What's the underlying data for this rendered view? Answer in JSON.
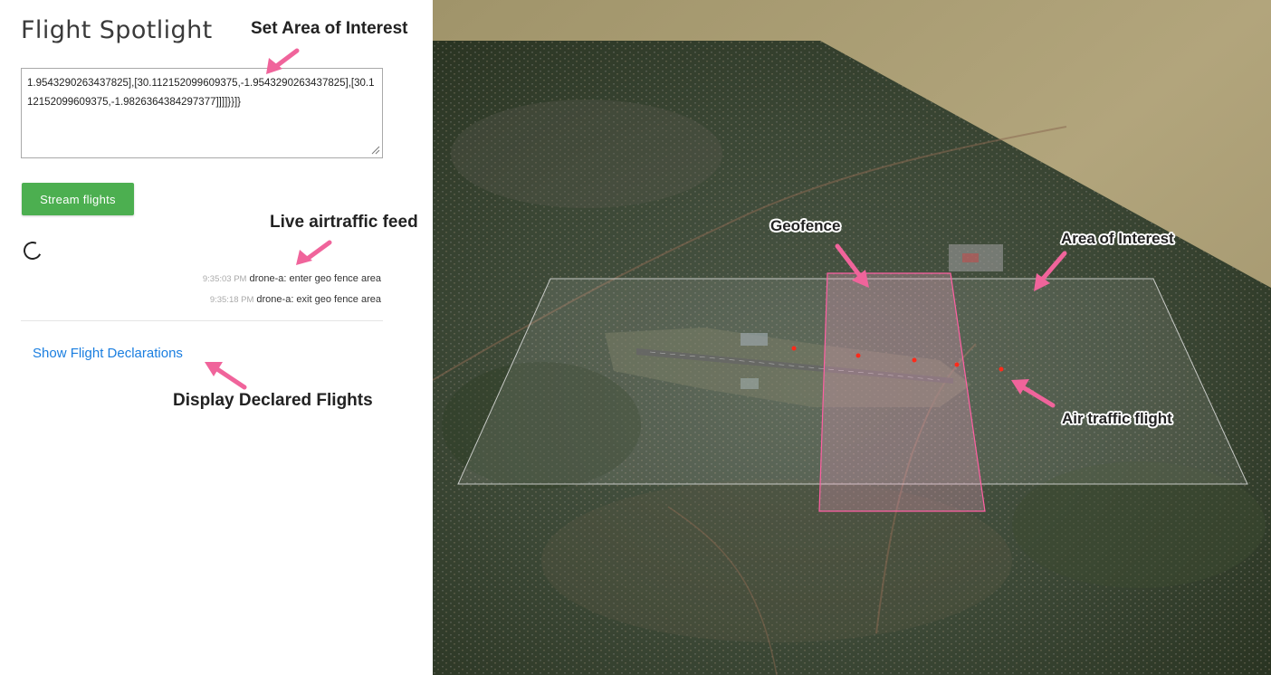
{
  "app": {
    "title": "Flight Spotlight"
  },
  "aoi_input": {
    "value": "1.9543290263437825],[30.112152099609375,-1.9543290263437825],[30.112152099609375,-1.9826364384297377]]]]}}]}"
  },
  "controls": {
    "stream_label": "Stream flights"
  },
  "feed": [
    {
      "time": "9:35:03 PM",
      "message": "drone-a: enter geo fence area"
    },
    {
      "time": "9:35:18 PM",
      "message": "drone-a: exit geo fence area"
    }
  ],
  "links": {
    "show_declarations": "Show Flight Declarations"
  },
  "annotations": {
    "set_aoi": "Set Area of Interest",
    "live_feed": "Live airtraffic feed",
    "display_declared": "Display Declared Flights",
    "geofence": "Geofence",
    "area_of_interest": "Area of Interest",
    "air_traffic_flight": "Air traffic flight"
  },
  "colors": {
    "accent_green": "#4caf50",
    "link_blue": "#1a7ee0",
    "annotation_arrow": "#f0649b",
    "geofence_stroke": "#ff5fa2",
    "flight_dot": "#ff2a1a"
  },
  "icons": [
    "loading-spinner-icon",
    "resize-grip-icon",
    "annotation-arrow-icon"
  ]
}
